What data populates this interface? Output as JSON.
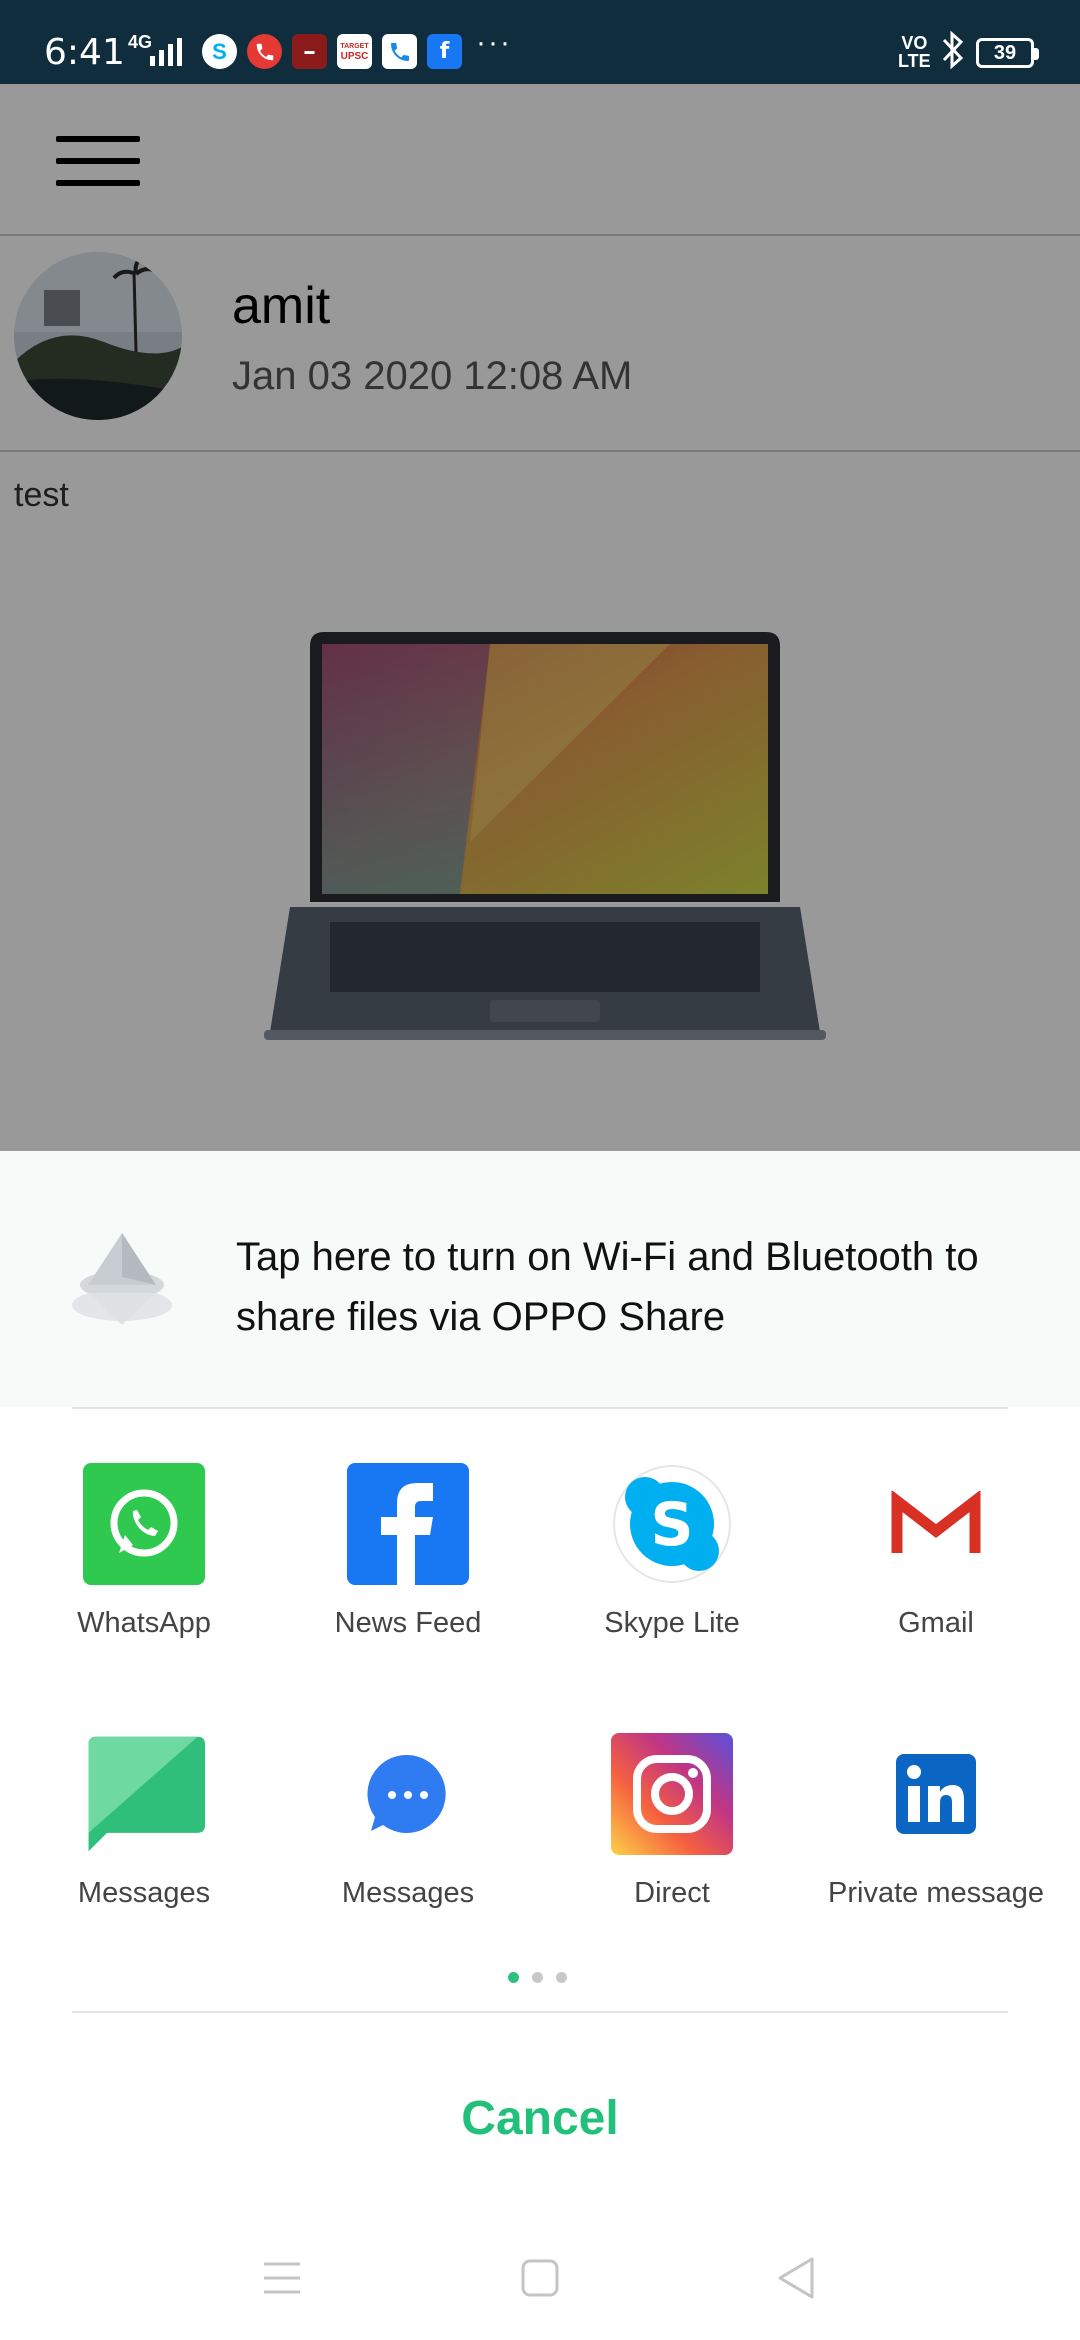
{
  "status_bar": {
    "time": "6:41",
    "network": "4G",
    "notification_icons": [
      "skype-icon",
      "phone-call-icon",
      "news-app-icon",
      "target-upsc-icon",
      "phone-icon",
      "facebook-icon"
    ],
    "target_upsc_label": "UPSC",
    "more": "···",
    "volte_line1": "VO",
    "volte_line2": "LTE",
    "battery": "39"
  },
  "app": {
    "post": {
      "username": "amit",
      "date": "Jan 03 2020 12:08 AM",
      "text": "test"
    }
  },
  "share_sheet": {
    "oppo_share_text": "Tap here to turn on Wi-Fi and Bluetooth to share files via OPPO Share",
    "apps": [
      {
        "label": "WhatsApp",
        "icon": "whatsapp-icon"
      },
      {
        "label": "News Feed",
        "icon": "facebook-icon"
      },
      {
        "label": "Skype Lite",
        "icon": "skype-icon"
      },
      {
        "label": "Gmail",
        "icon": "gmail-icon"
      },
      {
        "label": "Messages",
        "icon": "messages-icon"
      },
      {
        "label": "Messages",
        "icon": "chat-bubble-icon"
      },
      {
        "label": "Direct",
        "icon": "instagram-icon"
      },
      {
        "label": "Private message",
        "icon": "linkedin-icon"
      }
    ],
    "pager": {
      "pages": 3,
      "current": 1
    },
    "cancel_label": "Cancel"
  },
  "colors": {
    "status_bar": "#0f2d3d",
    "accent": "#22c07a",
    "whatsapp": "#2fc94f",
    "facebook": "#1877f2",
    "skype": "#00aff0",
    "gmail": "#d93025",
    "messages": "#2fbf7a",
    "linkedin": "#0a66c2"
  }
}
